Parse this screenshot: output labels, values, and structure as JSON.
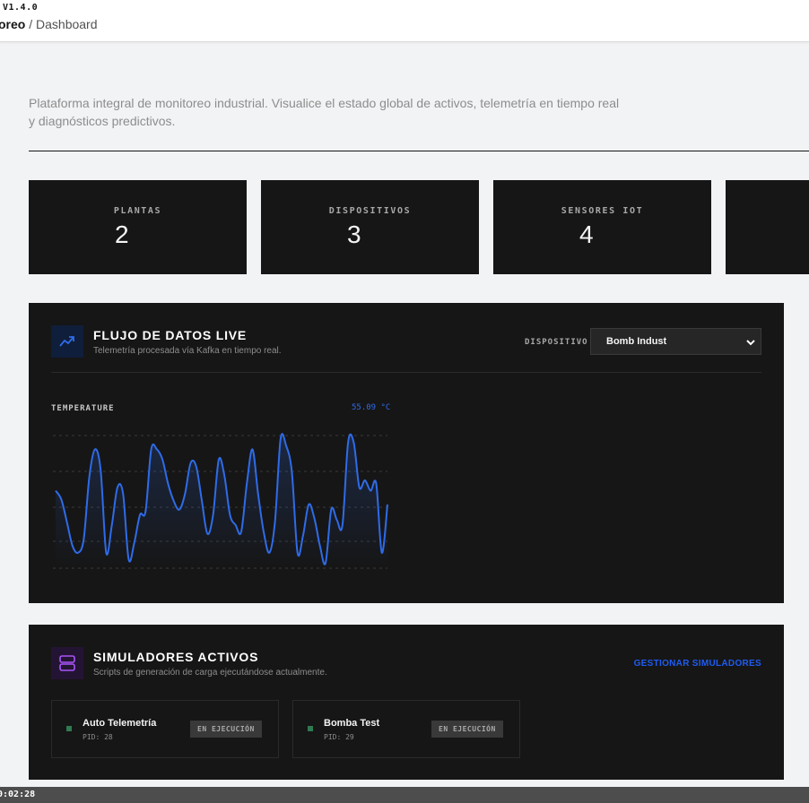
{
  "header": {
    "version": "V1.4.0",
    "breadcrumb_root": "oreo",
    "breadcrumb_separator": " / ",
    "breadcrumb_current": "Dashboard"
  },
  "intro": {
    "line1": "Plataforma integral de monitoreo industrial. Visualice el estado global de activos, telemetría en tiempo real",
    "line2": "y diagnósticos predictivos."
  },
  "stats": [
    {
      "label": "PLANTAS",
      "value": "2"
    },
    {
      "label": "DISPOSITIVOS",
      "value": "3"
    },
    {
      "label": "SENSORES IOT",
      "value": "4"
    }
  ],
  "live_panel": {
    "icon": "trending-up-icon",
    "title": "FLUJO DE DATOS LIVE",
    "subtitle": "Telemetría procesada vía Kafka en tiempo real.",
    "device_label": "DISPOSITIVO",
    "device_selected": "Bomb Indust",
    "metric_name": "TEMPERATURE",
    "metric_value": "55.09 °C"
  },
  "chart_data": {
    "type": "line",
    "title": "TEMPERATURE",
    "series": [
      {
        "color": "#2f6be8",
        "values": [
          58.0,
          57.5,
          56.2,
          54.8,
          54.4,
          55.2,
          58.8,
          60.4,
          59.2,
          54.4,
          56.0,
          58.2,
          57.8,
          54.0,
          55.0,
          56.6,
          56.8,
          60.4,
          60.4,
          59.8,
          58.4,
          57.4,
          56.9,
          57.8,
          59.6,
          59.4,
          57.4,
          55.5,
          56.6,
          59.8,
          58.9,
          56.6,
          56.0,
          55.6,
          58.4,
          60.4,
          57.8,
          55.6,
          54.4,
          56.2,
          61.0,
          60.6,
          59.1,
          54.4,
          55.4,
          57.2,
          56.4,
          54.8,
          53.8,
          56.9,
          56.3,
          56.0,
          60.8,
          60.8,
          58.2,
          58.6,
          58.0,
          58.4,
          54.4,
          57.2
        ]
      }
    ],
    "unit": "°C",
    "grid": true
  },
  "sim_panel": {
    "icon": "server-stack-icon",
    "title": "SIMULADORES ACTIVOS",
    "subtitle": "Scripts de generación de carga ejecutándose actualmente.",
    "manage_label": "GESTIONAR SIMULADORES",
    "items": [
      {
        "name": "Auto Telemetría",
        "pid": "PID: 28",
        "status": "EN EJECUCIÓN"
      },
      {
        "name": "Bomba Test",
        "pid": "PID: 29",
        "status": "EN EJECUCIÓN"
      }
    ]
  },
  "footer": {
    "clock": "0:02:28"
  },
  "colors": {
    "page_bg": "#f2f3f5",
    "card_bg": "#161616",
    "accent_blue": "#2f6be8",
    "link_blue": "#1f5cf2",
    "status_green": "#2f7a52",
    "purple_icon": "#a855f7"
  }
}
